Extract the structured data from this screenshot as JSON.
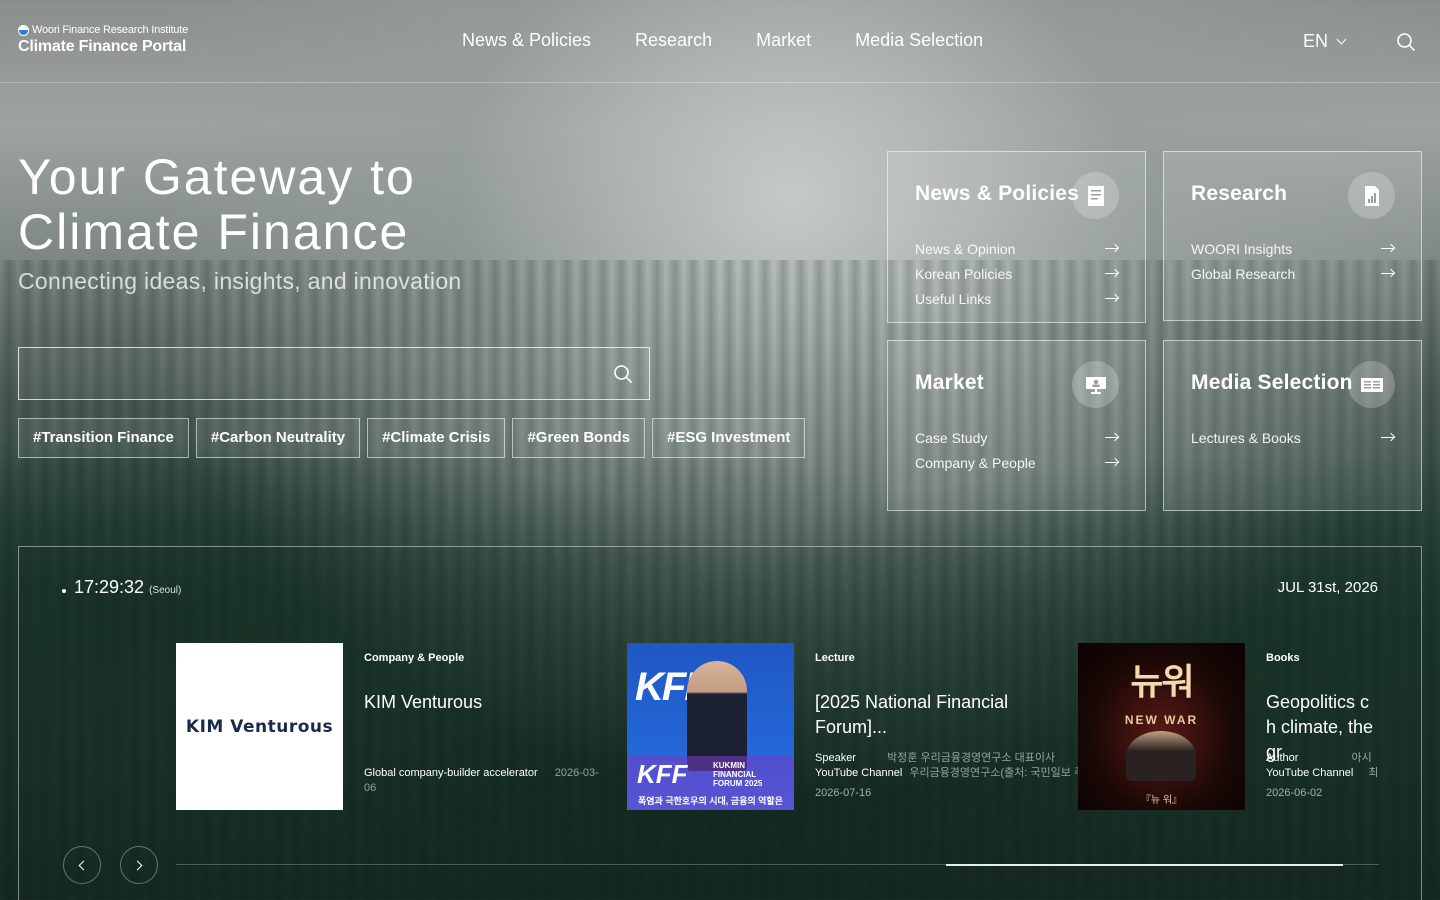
{
  "header": {
    "org": "Woori Finance Research Institute",
    "portal": "Climate Finance Portal",
    "nav": [
      "News & Policies",
      "Research",
      "Market",
      "Media Selection"
    ],
    "lang": "EN",
    "icons": {
      "search": "search-icon",
      "lang_toggle": "chevron-down-icon"
    }
  },
  "hero": {
    "title_line1": "Your Gateway to",
    "title_line2": "Climate Finance",
    "subtitle": "Connecting ideas, insights, and innovation",
    "search_placeholder": "",
    "tags": [
      "#Transition Finance",
      "#Carbon Neutrality",
      "#Climate Crisis",
      "#Green Bonds",
      "#ESG Investment"
    ]
  },
  "cards": [
    {
      "title": "News & Policies",
      "icon": "document-icon",
      "links": [
        "News & Opinion",
        "Korean Policies",
        "Useful Links"
      ]
    },
    {
      "title": "Research",
      "icon": "report-chart-icon",
      "links": [
        "WOORI Insights",
        "Global Research"
      ]
    },
    {
      "title": "Market",
      "icon": "presentation-icon",
      "links": [
        "Case Study",
        "Company & People"
      ]
    },
    {
      "title": "Media Selection",
      "icon": "newspaper-icon",
      "links": [
        "Lectures & Books"
      ]
    }
  ],
  "panel": {
    "time": "17:29:32",
    "city": "(Seoul)",
    "date": "JUL 31st, 2026",
    "progress": 0.33,
    "slides": [
      {
        "category": "Company & People",
        "title": "KIM Venturous",
        "thumb_text": "KIM Venturous",
        "meta_label": "Global company-builder accelerator",
        "meta_value": "2026-03-06",
        "date": ""
      },
      {
        "category": "Lecture",
        "title": "[2025 National Financial Forum]...",
        "thumb_text": "KFF",
        "thumb_sub": "KUKMIN FINANCIAL FORUM 2025",
        "thumb_caption": "폭염과 극한호우의 시대, 금융의 역할은",
        "meta1_label": "Speaker",
        "meta1_value": "박정훈 우리금융경영연구소 대표이사",
        "meta2_label": "YouTube Channel",
        "meta2_value": "우리금융경영연구소(출처: 국민일보 주식회사)",
        "date": "2026-07-16"
      },
      {
        "category": "Books",
        "title": "Geopolitics ch climate, the gr",
        "thumb_text": "뉴워",
        "thumb_sub": "NEW WAR",
        "thumb_caption": "『뉴 워』",
        "meta1_label": "Author",
        "meta1_value": "아시",
        "meta2_label": "YouTube Channel",
        "meta2_value": "최종",
        "date": "2026-06-02"
      }
    ]
  }
}
